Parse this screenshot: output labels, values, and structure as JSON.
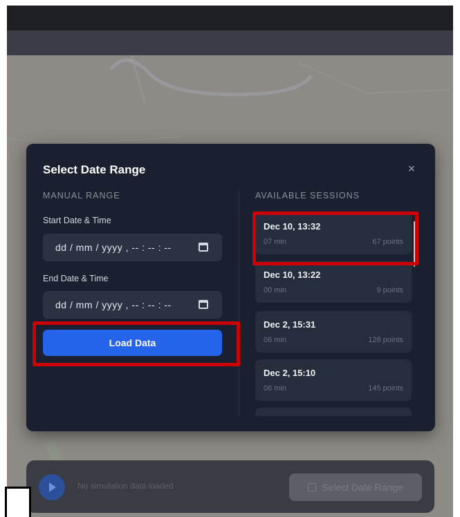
{
  "modal": {
    "title": "Select Date Range",
    "close_icon": "×",
    "manual": {
      "section_label": "MANUAL RANGE",
      "start_label": "Start Date & Time",
      "start_value": "dd / mm / yyyy ,  -- : -- : --",
      "end_label": "End Date & Time",
      "end_value": "dd / mm / yyyy ,  -- : -- : --",
      "load_label": "Load Data"
    },
    "sessions": {
      "section_label": "AVAILABLE SESSIONS",
      "items": [
        {
          "title": "Dec 10, 13:32",
          "duration": "07 min",
          "points": "67 points"
        },
        {
          "title": "Dec 10, 13:22",
          "duration": "00 min",
          "points": "9 points"
        },
        {
          "title": "Dec 2, 15:31",
          "duration": "06 min",
          "points": "128 points"
        },
        {
          "title": "Dec 2, 15:10",
          "duration": "06 min",
          "points": "145 points"
        }
      ]
    }
  },
  "background": {
    "status_text": "No simulation data loaded",
    "select_range_label": "Select Date Range"
  },
  "colors": {
    "accent": "#2563eb",
    "modal_bg": "#1a2030",
    "highlight": "#cc0000"
  }
}
